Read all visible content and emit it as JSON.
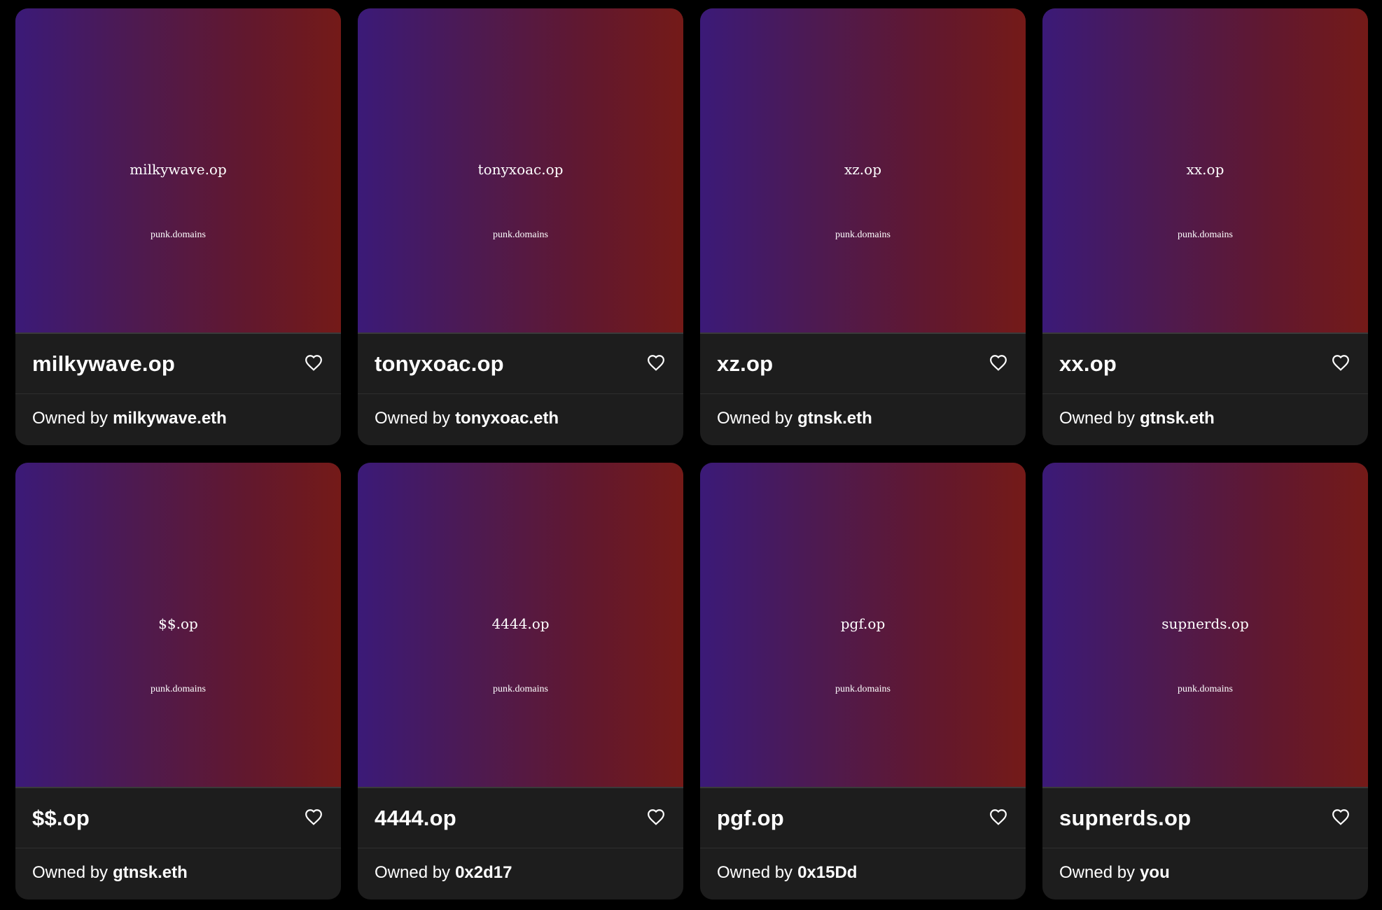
{
  "colors": {
    "background": "#000000",
    "card": "#1d1d1d",
    "gradient_start": "#3b1a78",
    "gradient_end": "#741a18",
    "text": "#ffffff"
  },
  "cards": [
    {
      "art_name": "milkywave.op",
      "art_sub": "punk.domains",
      "title": "milkywave.op",
      "owned_by_label": "Owned by",
      "owner": "milkywave.eth",
      "favorite_icon": "heart-outline-icon"
    },
    {
      "art_name": "tonyxoac.op",
      "art_sub": "punk.domains",
      "title": "tonyxoac.op",
      "owned_by_label": "Owned by",
      "owner": "tonyxoac.eth",
      "favorite_icon": "heart-outline-icon"
    },
    {
      "art_name": "xz.op",
      "art_sub": "punk.domains",
      "title": "xz.op",
      "owned_by_label": "Owned by",
      "owner": "gtnsk.eth",
      "favorite_icon": "heart-outline-icon"
    },
    {
      "art_name": "xx.op",
      "art_sub": "punk.domains",
      "title": "xx.op",
      "owned_by_label": "Owned by",
      "owner": "gtnsk.eth",
      "favorite_icon": "heart-outline-icon"
    },
    {
      "art_name": "$$.op",
      "art_sub": "punk.domains",
      "title": "$$.op",
      "owned_by_label": "Owned by",
      "owner": "gtnsk.eth",
      "favorite_icon": "heart-outline-icon"
    },
    {
      "art_name": "4444.op",
      "art_sub": "punk.domains",
      "title": "4444.op",
      "owned_by_label": "Owned by",
      "owner": "0x2d17",
      "favorite_icon": "heart-outline-icon"
    },
    {
      "art_name": "pgf.op",
      "art_sub": "punk.domains",
      "title": "pgf.op",
      "owned_by_label": "Owned by",
      "owner": "0x15Dd",
      "favorite_icon": "heart-outline-icon"
    },
    {
      "art_name": "supnerds.op",
      "art_sub": "punk.domains",
      "title": "supnerds.op",
      "owned_by_label": "Owned by",
      "owner": "you",
      "favorite_icon": "heart-outline-icon"
    }
  ]
}
